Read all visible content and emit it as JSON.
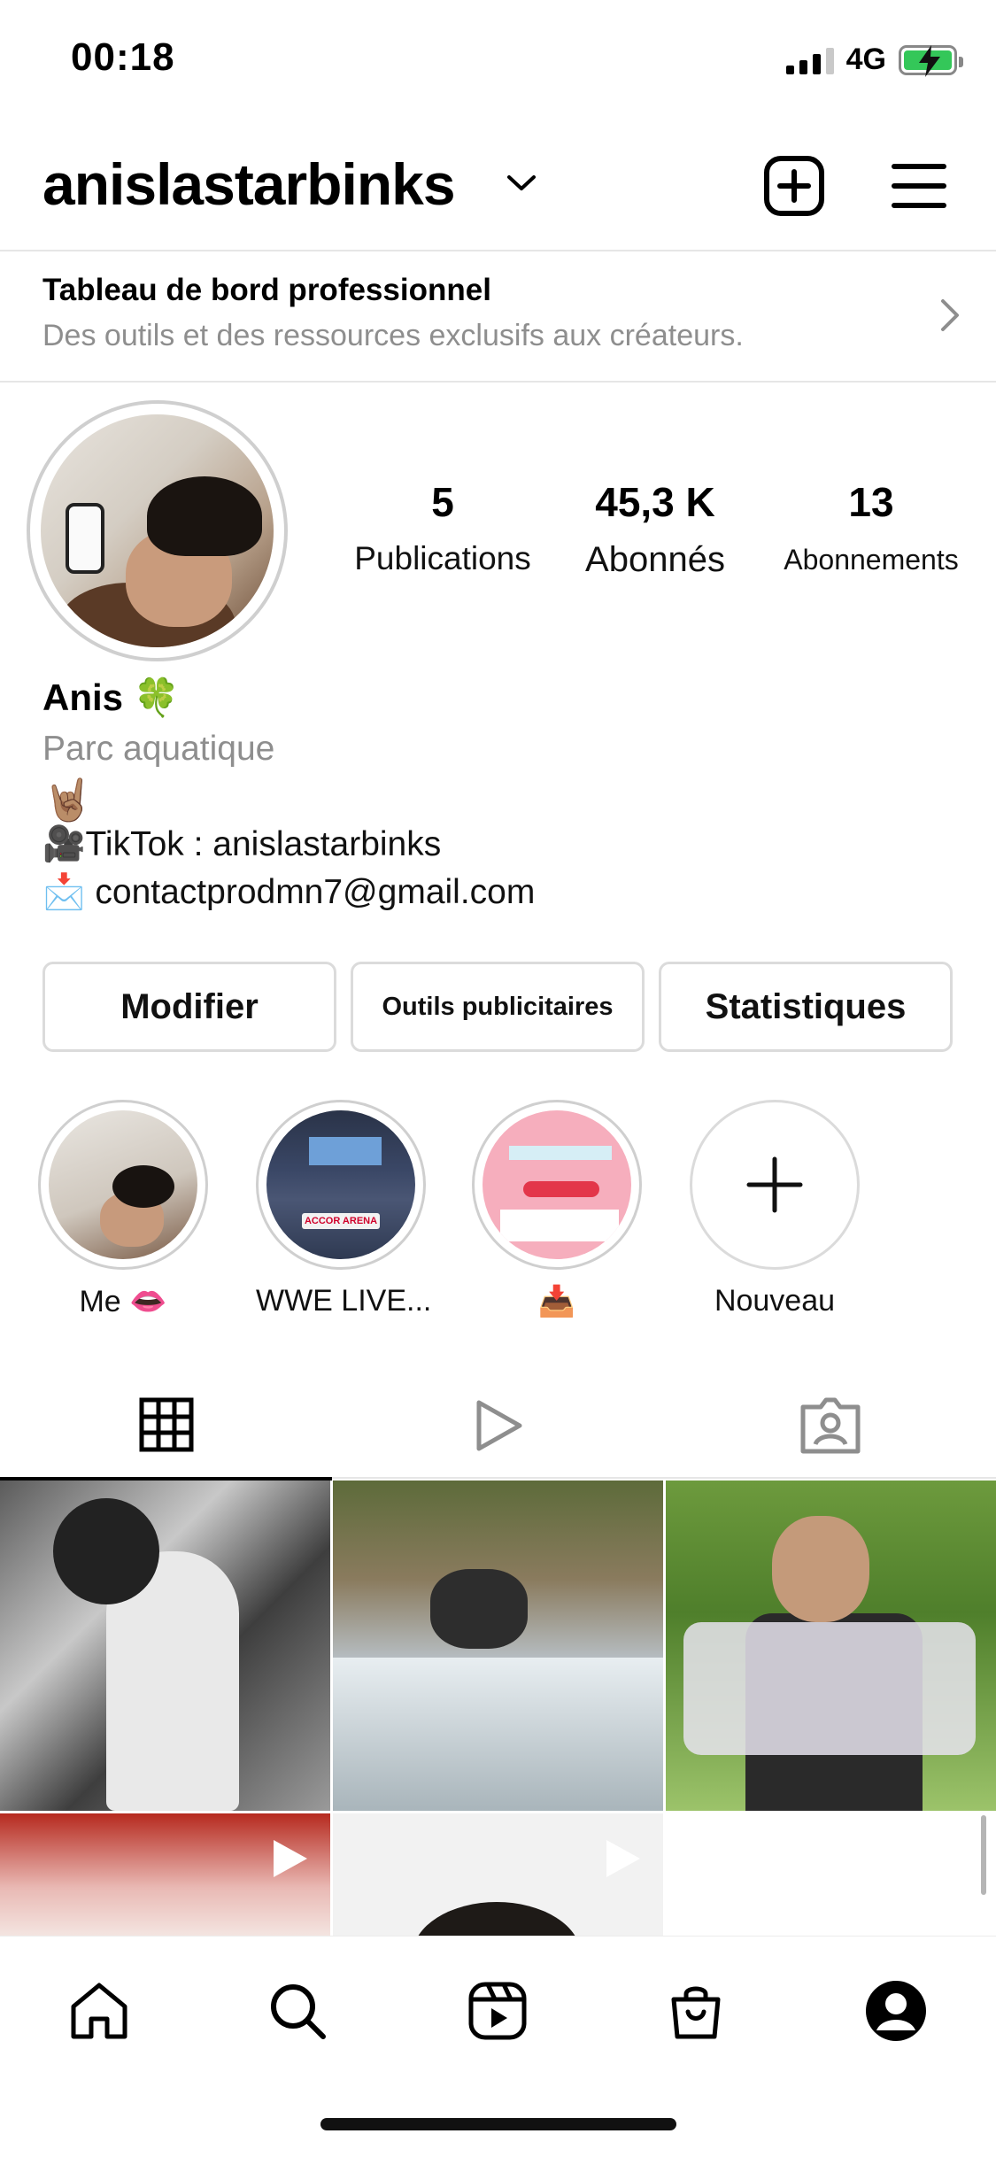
{
  "status_bar": {
    "time": "00:18",
    "network": "4G",
    "battery_charging": true,
    "battery_color": "#34c759"
  },
  "header": {
    "username": "anislastarbinks",
    "icons": [
      "chevron-down-icon",
      "add-post-icon",
      "menu-icon"
    ]
  },
  "professional_dashboard": {
    "title": "Tableau de bord professionnel",
    "subtitle": "Des outils et des ressources exclusifs aux créateurs."
  },
  "stats": {
    "posts": {
      "value": "5",
      "label": "Publications"
    },
    "followers": {
      "value": "45,3 K",
      "label": "Abonnés"
    },
    "following": {
      "value": "13",
      "label": "Abonnements"
    }
  },
  "bio": {
    "name": "Anis 🍀",
    "category": "Parc aquatique",
    "lines": [
      "🤘🏽",
      "🎥TikTok : anislastarbinks",
      "📩 contactprodmn7@gmail.com"
    ]
  },
  "buttons": {
    "edit": "Modifier",
    "ads_tools": "Outils publicitaires",
    "insights": "Statistiques"
  },
  "highlights": [
    {
      "label": "Me 👄"
    },
    {
      "label": "WWE LIVE..."
    },
    {
      "label": "📥"
    },
    {
      "label": "Nouveau"
    }
  ],
  "highlight_thumbs": {
    "wwe_sign": "ACCOR ARENA"
  },
  "tabs": [
    {
      "name": "grid",
      "icon": "grid-icon",
      "active": true
    },
    {
      "name": "reels",
      "icon": "reels-play-icon",
      "active": false
    },
    {
      "name": "tagged",
      "icon": "tagged-person-icon",
      "active": false
    }
  ],
  "posts": [
    {
      "type": "photo"
    },
    {
      "type": "photo"
    },
    {
      "type": "photo"
    },
    {
      "type": "reel"
    },
    {
      "type": "reel"
    }
  ],
  "bottom_nav": [
    {
      "name": "home",
      "icon": "home-icon"
    },
    {
      "name": "search",
      "icon": "search-icon"
    },
    {
      "name": "reels",
      "icon": "reels-icon"
    },
    {
      "name": "shop",
      "icon": "shop-icon"
    },
    {
      "name": "profile",
      "icon": "profile-icon"
    }
  ]
}
